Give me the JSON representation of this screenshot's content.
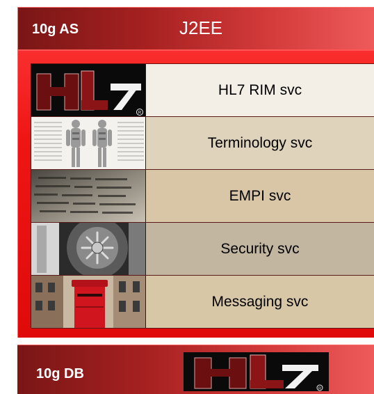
{
  "app_server": {
    "label": "10g AS",
    "platform": "J2EE"
  },
  "services": [
    {
      "label": "HL7 RIM svc",
      "image": "hl7-logo"
    },
    {
      "label": "Terminology  svc",
      "image": "anatomy-chart"
    },
    {
      "label": "EMPI svc",
      "image": "printed-records"
    },
    {
      "label": "Security svc",
      "image": "vault-door"
    },
    {
      "label": "Messaging svc",
      "image": "red-postbox"
    }
  ],
  "database": {
    "label": "10g DB",
    "logo": "hl7-logo"
  },
  "colors": {
    "panel_red": "#e00a0a",
    "header_dark_red": "#7a1616",
    "row_light": "#f3efe7",
    "row_tan": "#d9c6a6"
  }
}
